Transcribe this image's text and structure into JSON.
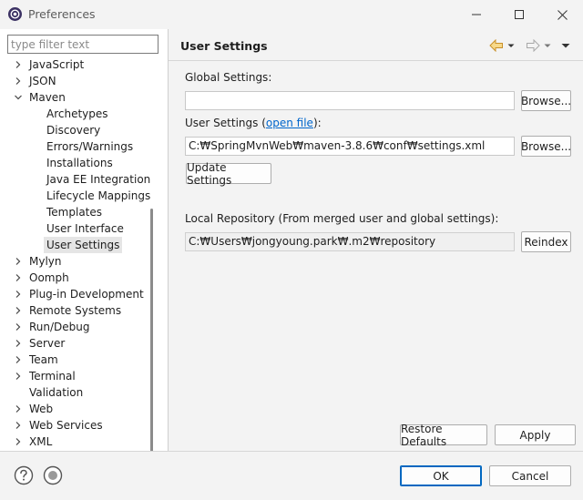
{
  "window": {
    "title": "Preferences"
  },
  "filter": {
    "placeholder": "type filter text"
  },
  "tree": {
    "items": [
      {
        "label": "JavaScript",
        "expandable": true,
        "expanded": false,
        "level": 0
      },
      {
        "label": "JSON",
        "expandable": true,
        "expanded": false,
        "level": 0
      },
      {
        "label": "Maven",
        "expandable": true,
        "expanded": true,
        "level": 0
      },
      {
        "label": "Archetypes",
        "expandable": false,
        "level": 1
      },
      {
        "label": "Discovery",
        "expandable": false,
        "level": 1
      },
      {
        "label": "Errors/Warnings",
        "expandable": false,
        "level": 1
      },
      {
        "label": "Installations",
        "expandable": false,
        "level": 1
      },
      {
        "label": "Java EE Integration",
        "expandable": false,
        "level": 1
      },
      {
        "label": "Lifecycle Mappings",
        "expandable": false,
        "level": 1
      },
      {
        "label": "Templates",
        "expandable": false,
        "level": 1
      },
      {
        "label": "User Interface",
        "expandable": false,
        "level": 1
      },
      {
        "label": "User Settings",
        "expandable": false,
        "level": 1,
        "selected": true
      },
      {
        "label": "Mylyn",
        "expandable": true,
        "expanded": false,
        "level": 0
      },
      {
        "label": "Oomph",
        "expandable": true,
        "expanded": false,
        "level": 0
      },
      {
        "label": "Plug-in Development",
        "expandable": true,
        "expanded": false,
        "level": 0
      },
      {
        "label": "Remote Systems",
        "expandable": true,
        "expanded": false,
        "level": 0
      },
      {
        "label": "Run/Debug",
        "expandable": true,
        "expanded": false,
        "level": 0
      },
      {
        "label": "Server",
        "expandable": true,
        "expanded": false,
        "level": 0
      },
      {
        "label": "Team",
        "expandable": true,
        "expanded": false,
        "level": 0
      },
      {
        "label": "Terminal",
        "expandable": true,
        "expanded": false,
        "level": 0
      },
      {
        "label": "Validation",
        "expandable": false,
        "level": 0
      },
      {
        "label": "Web",
        "expandable": true,
        "expanded": false,
        "level": 0
      },
      {
        "label": "Web Services",
        "expandable": true,
        "expanded": false,
        "level": 0
      },
      {
        "label": "XML",
        "expandable": true,
        "expanded": false,
        "level": 0
      }
    ]
  },
  "page": {
    "title": "User Settings",
    "global_settings_label": "Global Settings:",
    "global_settings_value": "",
    "browse_label": "Browse...",
    "user_settings_label_prefix": "User Settings (",
    "user_settings_link": "open file",
    "user_settings_label_suffix": "):",
    "user_settings_value": "C:₩SpringMvnWeb₩maven-3.8.6₩conf₩settings.xml",
    "update_settings_label": "Update Settings",
    "local_repo_label": "Local Repository (From merged user and global settings):",
    "local_repo_value": "C:₩Users₩jongyoung.park₩.m2₩repository",
    "reindex_label": "Reindex",
    "restore_defaults_label": "Restore Defaults",
    "apply_label": "Apply"
  },
  "footer": {
    "ok_label": "OK",
    "cancel_label": "Cancel"
  },
  "colors": {
    "accent": "#0067c0",
    "link": "#0066cc",
    "nav_back": "#d9a13a"
  }
}
